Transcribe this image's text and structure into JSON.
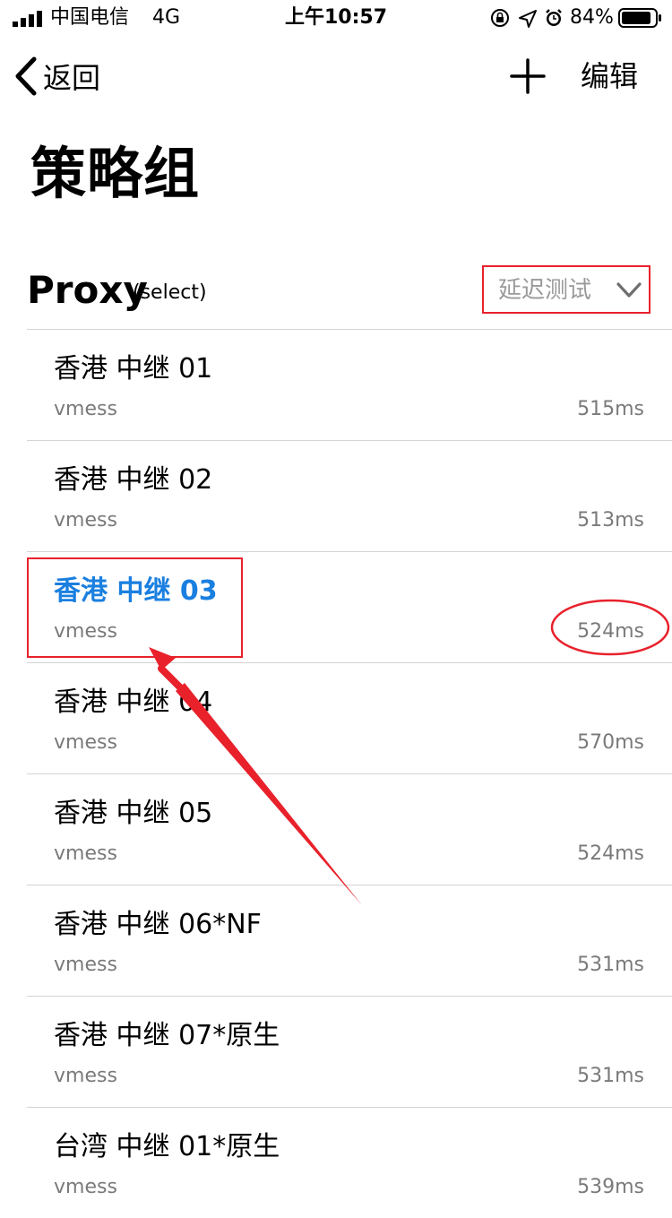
{
  "status_bar": {
    "carrier": "中国电信",
    "network": "4G",
    "time": "上午10:57",
    "battery": "84%",
    "icons": [
      "orientation-lock-icon",
      "location-icon",
      "alarm-icon"
    ]
  },
  "nav": {
    "back_label": "返回",
    "add_icon": "plus-icon",
    "edit_label": "编辑"
  },
  "page_title": "策略组",
  "section": {
    "name": "Proxy",
    "type": "(select)",
    "latency_test_label": "延迟测试"
  },
  "proxies": [
    {
      "name": "香港 中继 01",
      "protocol": "vmess",
      "latency": "515ms",
      "selected": false
    },
    {
      "name": "香港 中继 02",
      "protocol": "vmess",
      "latency": "513ms",
      "selected": false
    },
    {
      "name": "香港 中继 03",
      "protocol": "vmess",
      "latency": "524ms",
      "selected": true
    },
    {
      "name": "香港 中继 04",
      "protocol": "vmess",
      "latency": "570ms",
      "selected": false
    },
    {
      "name": "香港 中继 05",
      "protocol": "vmess",
      "latency": "524ms",
      "selected": false
    },
    {
      "name": "香港 中继 06*NF",
      "protocol": "vmess",
      "latency": "531ms",
      "selected": false
    },
    {
      "name": "香港 中继 07*原生",
      "protocol": "vmess",
      "latency": "531ms",
      "selected": false
    },
    {
      "name": "台湾 中继 01*原生",
      "protocol": "vmess",
      "latency": "539ms",
      "selected": false
    }
  ],
  "colors": {
    "selected_accent": "#1a7fe0",
    "annotation_red": "#e8212b",
    "secondary_text": "#7a7a7a"
  }
}
